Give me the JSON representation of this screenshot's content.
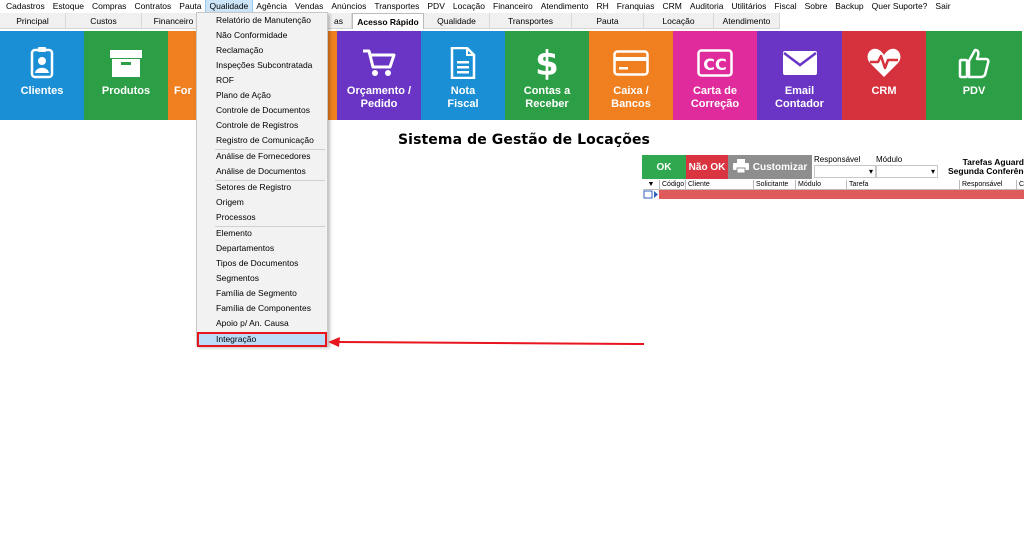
{
  "menubar": [
    "Cadastros",
    "Estoque",
    "Compras",
    "Contratos",
    "Pauta",
    "Qualidade",
    "Agência",
    "Vendas",
    "Anúncios",
    "Transportes",
    "PDV",
    "Locação",
    "Financeiro",
    "Atendimento",
    "RH",
    "Franquias",
    "CRM",
    "Auditoria",
    "Utilitários",
    "Fiscal",
    "Sobre",
    "Backup",
    "Quer Suporte?",
    "Sair"
  ],
  "active_menu": "Qualidade",
  "tabs": [
    "Principal",
    "Custos",
    "Financeiro",
    "",
    "as",
    "Acesso Rápido",
    "Qualidade",
    "Transportes",
    "Pauta",
    "Locação",
    "Atendimento"
  ],
  "active_tab": "Acesso Rápido",
  "tiles": [
    {
      "label": "Clientes",
      "icon": "user-badge-icon",
      "color": "#1a8fd6"
    },
    {
      "label": "Produtos",
      "icon": "box-icon",
      "color": "#2c9f46"
    },
    {
      "label": "For",
      "icon": "",
      "color": "#f07f1f"
    },
    {
      "label": "",
      "icon": "",
      "color": "#f07f1f"
    },
    {
      "label": "Orçamento /\nPedido",
      "icon": "cart-icon",
      "color": "#6a35c4"
    },
    {
      "label": "Nota\nFiscal",
      "icon": "document-icon",
      "color": "#1a8fd6"
    },
    {
      "label": "Contas a\nReceber",
      "icon": "dollar-icon",
      "color": "#2c9f46"
    },
    {
      "label": "Caixa /\nBancos",
      "icon": "credit-card-icon",
      "color": "#f07f1f"
    },
    {
      "label": "Carta de\nCorreção",
      "icon": "cc-icon",
      "color": "#df2b9c"
    },
    {
      "label": "Email\nContador",
      "icon": "envelope-icon",
      "color": "#6a35c4"
    },
    {
      "label": "CRM",
      "icon": "heart-pulse-icon",
      "color": "#d6323e"
    },
    {
      "label": "PDV",
      "icon": "thumbs-up-icon",
      "color": "#2c9f46"
    }
  ],
  "page_title": "Sistema de Gestão de Locações",
  "tasks": {
    "ok_label": "OK",
    "nok_label": "Não OK",
    "customize_label": "Customizar",
    "responsavel_label": "Responsável",
    "modulo_label": "Módulo",
    "title_line1": "Tarefas Aguard",
    "title_line2": "Segunda Conferênc",
    "columns": [
      "Código",
      "Cliente",
      "Solicitante",
      "Módulo",
      "Tarefa",
      "Responsável",
      "Ci"
    ]
  },
  "dropdown": {
    "items": [
      "Relatório de Manutenção",
      "Não Conformidade",
      "Reclamação",
      "Inspeções Subcontratada",
      "ROF",
      "Plano de Ação",
      "Controle de Documentos",
      "Controle de Registros",
      "Registro de Comunicação",
      "Análise de Fornecedores",
      "Análise de Documentos",
      "Setores de Registro",
      "Origem",
      "Processos",
      "Elemento",
      "Departamentos",
      "Tipos de Documentos",
      "Segmentos",
      "Família de Segmento",
      "Família de Componentes",
      "Apoio p/ An. Causa",
      "Integração"
    ],
    "highlighted": "Integração"
  },
  "colors": {
    "highlight_border": "#e8141e",
    "ok_green": "#2fa84f",
    "nok_red": "#d9343f",
    "grid_row": "#df5a5a"
  }
}
